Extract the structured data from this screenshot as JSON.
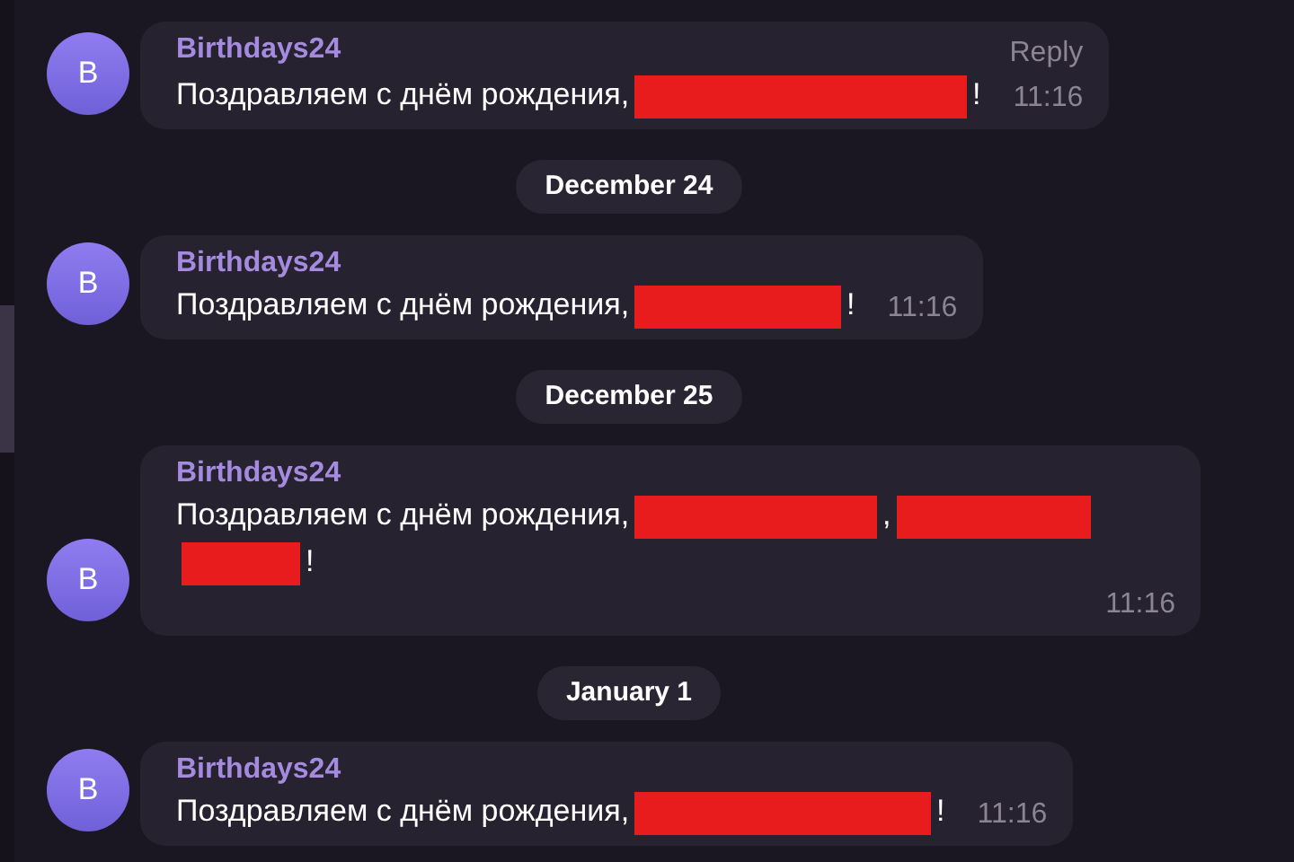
{
  "feed": [
    {
      "kind": "message",
      "avatar": "B",
      "sender": "Birthdays24",
      "action": "Reply",
      "time": "11:16",
      "parts": [
        {
          "kind": "text",
          "text": "Поздравляем с днём рождения,"
        },
        {
          "kind": "redaction"
        },
        {
          "kind": "text",
          "text": "!"
        }
      ]
    },
    {
      "kind": "date",
      "label": "December 24"
    },
    {
      "kind": "message",
      "avatar": "B",
      "sender": "Birthdays24",
      "time": "11:16",
      "parts": [
        {
          "kind": "text",
          "text": "Поздравляем с днём рождения,"
        },
        {
          "kind": "redaction"
        },
        {
          "kind": "text",
          "text": "!"
        }
      ]
    },
    {
      "kind": "date",
      "label": "December 25"
    },
    {
      "kind": "message",
      "avatar": "B",
      "sender": "Birthdays24",
      "time": "11:16",
      "parts": [
        {
          "kind": "text",
          "text": "Поздравляем с днём рождения,"
        },
        {
          "kind": "redaction"
        },
        {
          "kind": "text",
          "text": ","
        },
        {
          "kind": "redaction"
        },
        {
          "kind": "redaction"
        },
        {
          "kind": "text",
          "text": "!"
        }
      ]
    },
    {
      "kind": "date",
      "label": "January 1"
    },
    {
      "kind": "message",
      "avatar": "B",
      "sender": "Birthdays24",
      "time": "11:16",
      "parts": [
        {
          "kind": "text",
          "text": "Поздравляем с днём рождения,"
        },
        {
          "kind": "redaction"
        },
        {
          "kind": "text",
          "text": "!"
        }
      ]
    }
  ]
}
